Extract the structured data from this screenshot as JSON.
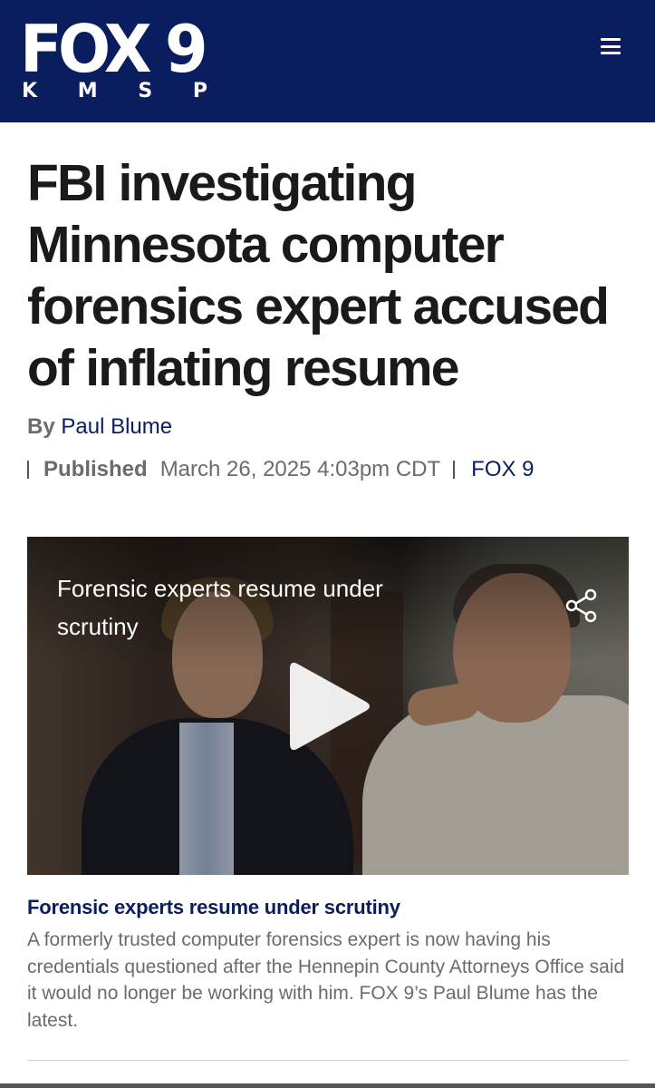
{
  "header": {
    "logo_main": "FOX 9",
    "logo_sub": [
      "K",
      "M",
      "S",
      "P"
    ],
    "menu_icon": "hamburger-menu-icon"
  },
  "article": {
    "headline": "FBI investigating Minnesota computer forensics expert accused of inflating resume",
    "byline_prefix": "By",
    "author": "Paul Blume",
    "published_label": "Published",
    "published_date": "March 26, 2025 4:03pm CDT",
    "source": "FOX 9"
  },
  "video": {
    "overlay_title": "Forensic experts resume under scrutiny",
    "share_icon": "share-icon",
    "play_icon": "play-icon"
  },
  "caption": {
    "title": "Forensic experts resume under scrutiny",
    "body": "A formerly trusted computer forensics expert is now having his credentials questioned after the Hennepin County Attorneys Office said it would no longer be working with him. FOX 9’s Paul Blume has the latest."
  },
  "colors": {
    "brand_navy": "#0a1d5e",
    "header_bg": "#0a1d5e",
    "meta_gray": "#6b6b6b"
  }
}
